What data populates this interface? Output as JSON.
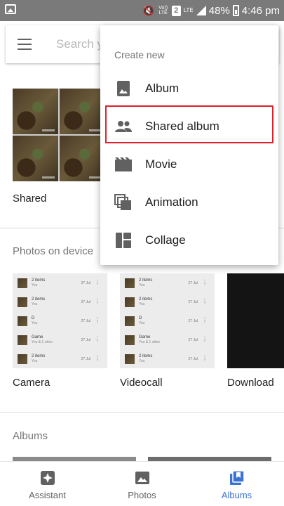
{
  "status_bar": {
    "volte": "Vo)) LTE",
    "sim": "2",
    "lte": "LTE",
    "battery": "48%",
    "time": "4:46 pm"
  },
  "search": {
    "placeholder": "Search y"
  },
  "shared": {
    "label": "Shared"
  },
  "device": {
    "header": "Photos on device",
    "folders": [
      {
        "label": "Camera"
      },
      {
        "label": "Videocall"
      },
      {
        "label": "Download"
      }
    ],
    "tile_rows": [
      {
        "title": "2 items",
        "sub": "You",
        "date": "27 Jul"
      },
      {
        "title": "2 items",
        "sub": "You",
        "date": "27 Jul"
      },
      {
        "title": "D",
        "sub": "You",
        "date": "27 Jul"
      },
      {
        "title": "Game",
        "sub": "You & 1 other",
        "date": "27 Jul"
      },
      {
        "title": "2 items",
        "sub": "You",
        "date": "27 Jul"
      }
    ]
  },
  "albums": {
    "header": "Albums"
  },
  "bottom_nav": {
    "items": [
      {
        "label": "Assistant",
        "icon": "assistant-icon"
      },
      {
        "label": "Photos",
        "icon": "photos-icon"
      },
      {
        "label": "Albums",
        "icon": "albums-icon",
        "active": true
      }
    ],
    "active_color": "#3b73d4"
  },
  "menu": {
    "title": "Create new",
    "items": [
      {
        "label": "Album",
        "icon": "album-icon"
      },
      {
        "label": "Shared album",
        "icon": "people-icon",
        "highlighted": true
      },
      {
        "label": "Movie",
        "icon": "movie-icon"
      },
      {
        "label": "Animation",
        "icon": "animation-icon"
      },
      {
        "label": "Collage",
        "icon": "collage-icon"
      }
    ],
    "highlight_color": "#e0202a"
  }
}
